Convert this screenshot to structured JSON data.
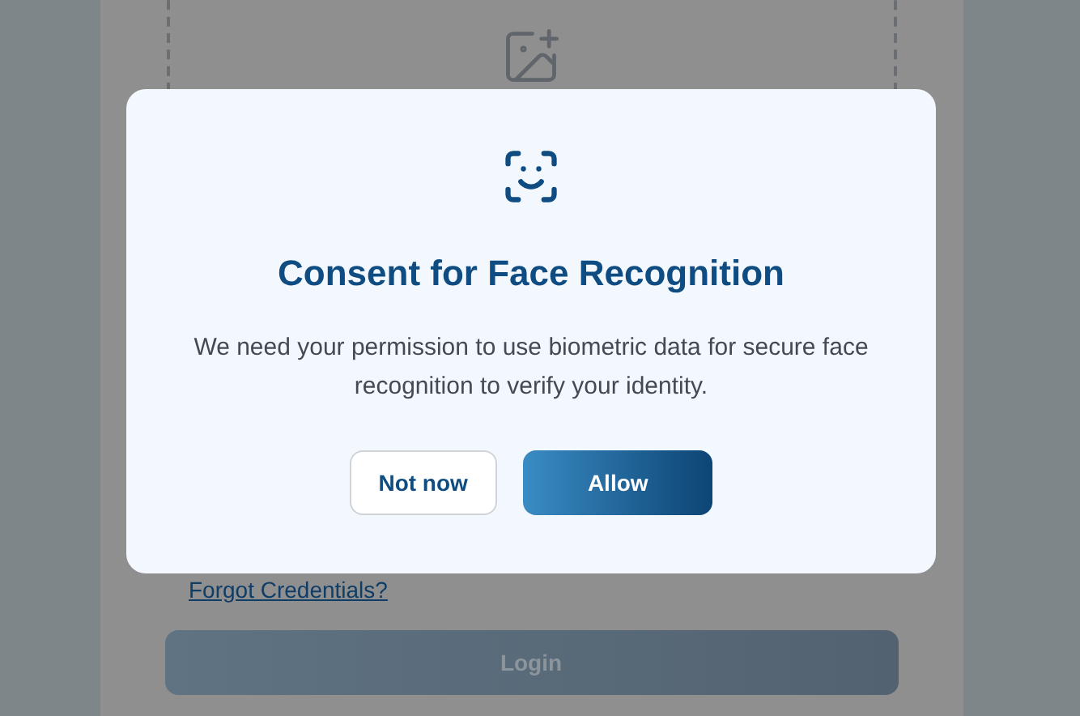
{
  "background": {
    "forgot_link": "Forgot Credentials?",
    "login_button": {
      "label": "Login",
      "disabled": true
    }
  },
  "dialog": {
    "title": "Consent for Face Recognition",
    "message": "We need your permission to use biometric data for secure face recognition to verify your identity.",
    "buttons": [
      {
        "label": "Not now",
        "kind": "secondary"
      },
      {
        "label": "Allow",
        "kind": "primary"
      }
    ]
  }
}
